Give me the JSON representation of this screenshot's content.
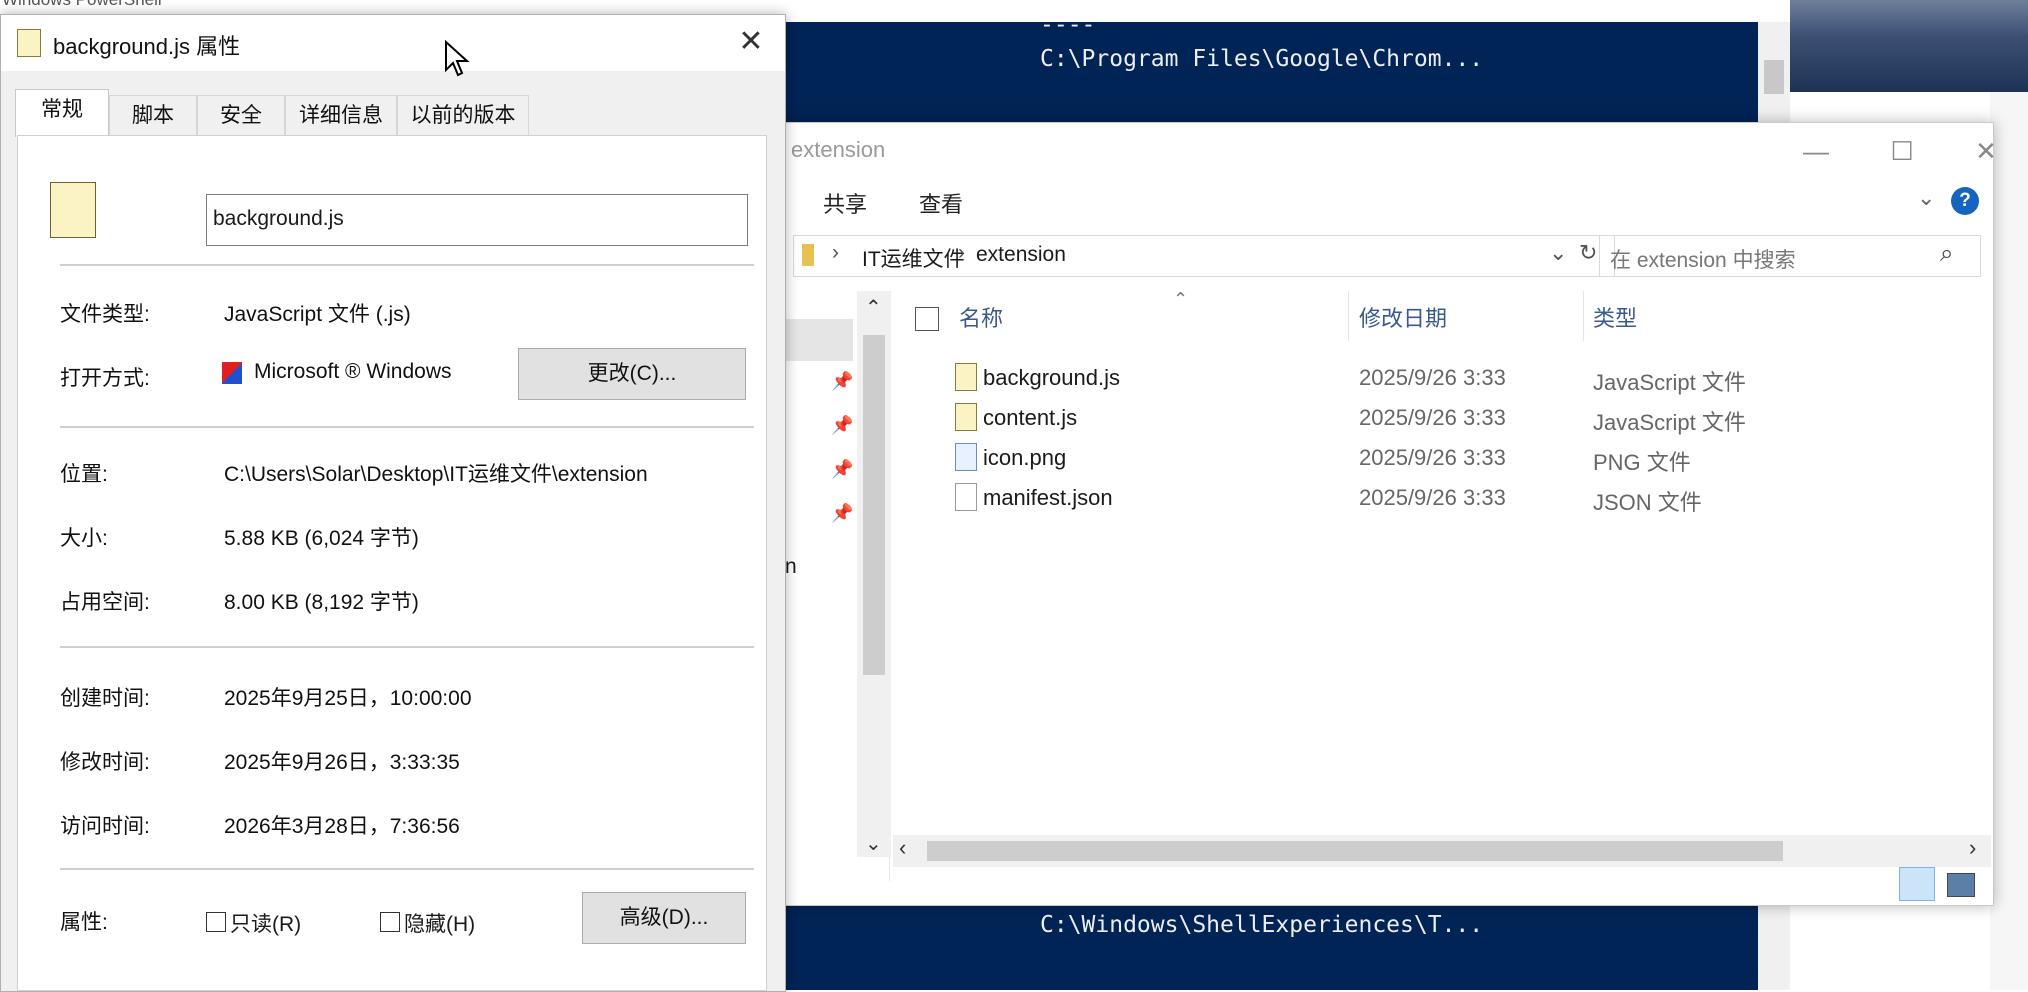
{
  "powershell": {
    "title": "Windows PowerShell",
    "dashes": "----",
    "line1": "C:\\Program Files\\Google\\Chrom...",
    "line2": "C:\\Windows\\ShellExperiences\\T..."
  },
  "explorer": {
    "title": "extension",
    "ribbon": [
      "共享",
      "查看"
    ],
    "help": "?",
    "breadcrumb": [
      "IT运维文件",
      "extension"
    ],
    "search_placeholder": "在 extension 中搜索",
    "nav_partial_text": "n",
    "columns": [
      "名称",
      "修改日期",
      "类型"
    ],
    "files": [
      {
        "name": "background.js",
        "date": "2025/9/26 3:33",
        "type": "JavaScript 文件",
        "icon": "js-file-icon"
      },
      {
        "name": "content.js",
        "date": "2025/9/26 3:33",
        "type": "JavaScript 文件",
        "icon": "js-file-icon"
      },
      {
        "name": "icon.png",
        "date": "2025/9/26 3:33",
        "type": "PNG 文件",
        "icon": "png-file-icon"
      },
      {
        "name": "manifest.json",
        "date": "2025/9/26 3:33",
        "type": "JSON 文件",
        "icon": "json-file-icon"
      }
    ]
  },
  "properties": {
    "title": "background.js 属性",
    "tabs": [
      "常规",
      "脚本",
      "安全",
      "详细信息",
      "以前的版本"
    ],
    "filename": "background.js",
    "file_type_label": "文件类型:",
    "file_type": "JavaScript 文件 (.js)",
    "open_with_label": "打开方式:",
    "open_with": "Microsoft ® Windows",
    "change_button": "更改(C)...",
    "location_label": "位置:",
    "location": "C:\\Users\\Solar\\Desktop\\IT运维文件\\extension",
    "size_label": "大小:",
    "size": "5.88 KB (6,024 字节)",
    "disk_size_label": "占用空间:",
    "disk_size": "8.00 KB (8,192 字节)",
    "created_label": "创建时间:",
    "created": "2025年9月25日，10:00:00",
    "modified_label": "修改时间:",
    "modified": "2025年9月26日，3:33:35",
    "accessed_label": "访问时间:",
    "accessed": "2026年3月28日，7:36:56",
    "attributes_label": "属性:",
    "readonly": "只读(R)",
    "hidden": "隐藏(H)",
    "advanced_button": "高级(D)..."
  }
}
